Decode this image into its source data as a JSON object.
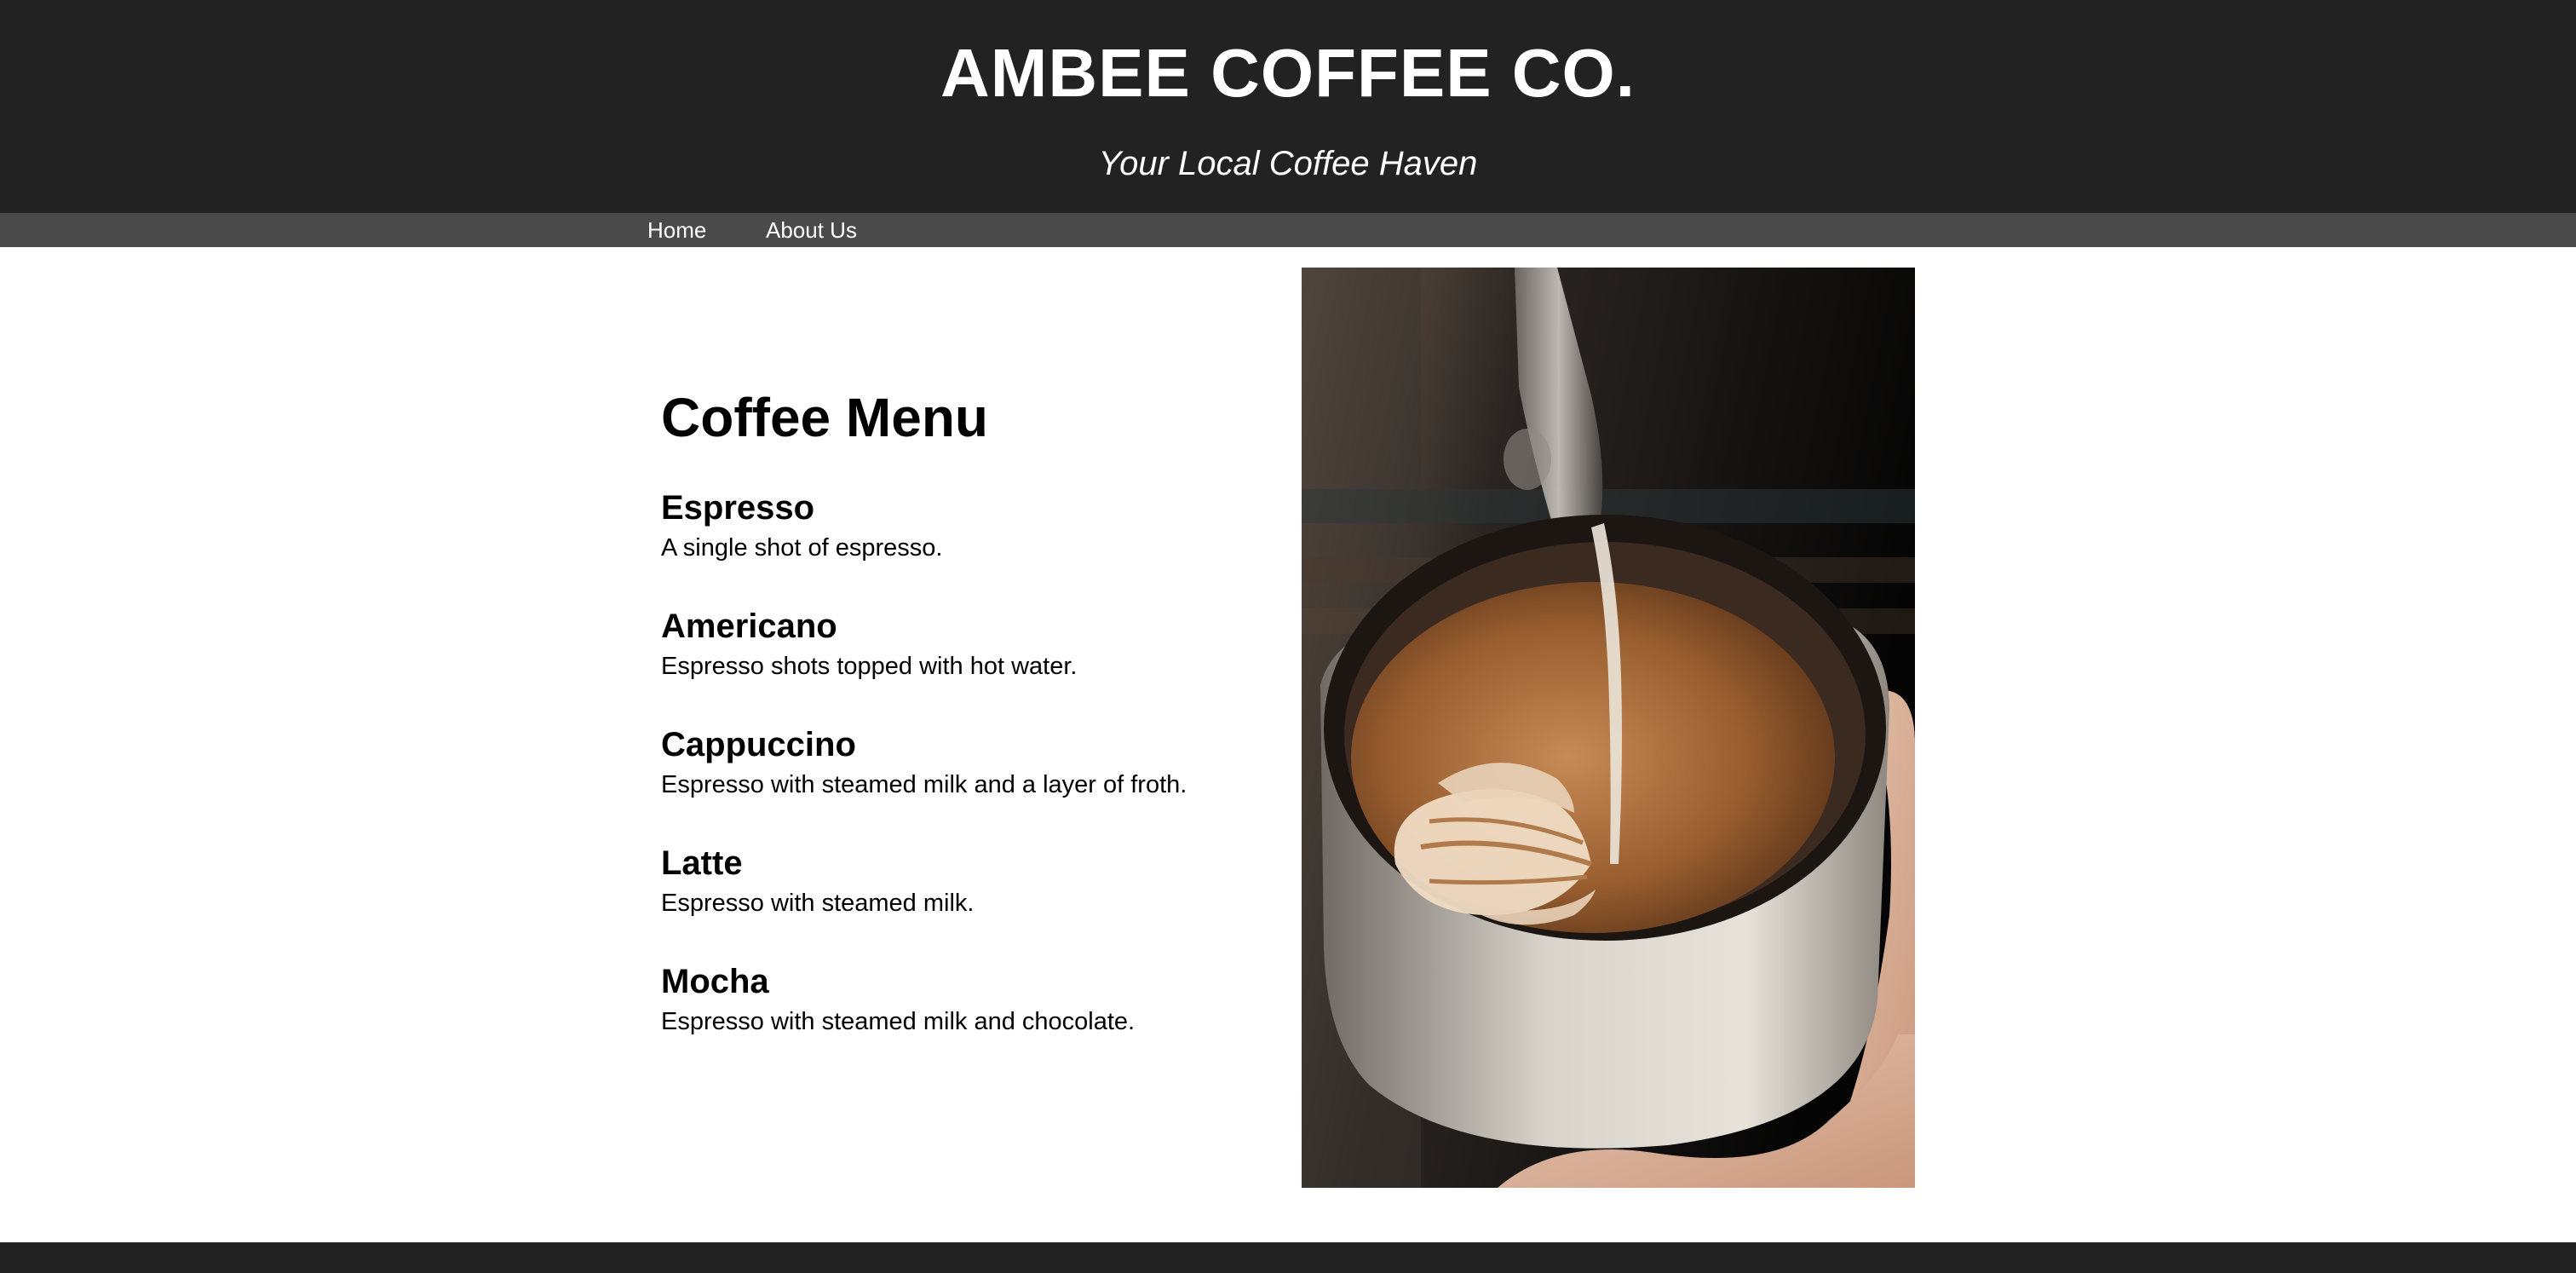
{
  "header": {
    "title": "AMBEE COFFEE CO.",
    "tagline": "Your Local Coffee Haven"
  },
  "nav": {
    "items": [
      {
        "label": "Home"
      },
      {
        "label": "About Us"
      }
    ]
  },
  "menu": {
    "heading": "Coffee Menu",
    "items": [
      {
        "name": "Espresso",
        "description": "A single shot of espresso."
      },
      {
        "name": "Americano",
        "description": "Espresso shots topped with hot water."
      },
      {
        "name": "Cappuccino",
        "description": "Espresso with steamed milk and a layer of froth."
      },
      {
        "name": "Latte",
        "description": "Espresso with steamed milk."
      },
      {
        "name": "Mocha",
        "description": "Espresso with steamed milk and chocolate."
      }
    ]
  },
  "colors": {
    "header_bg": "#222222",
    "nav_bg": "#4a4a4a",
    "footer_bg": "#222222",
    "text_light": "#ffffff",
    "text_dark": "#000000"
  }
}
